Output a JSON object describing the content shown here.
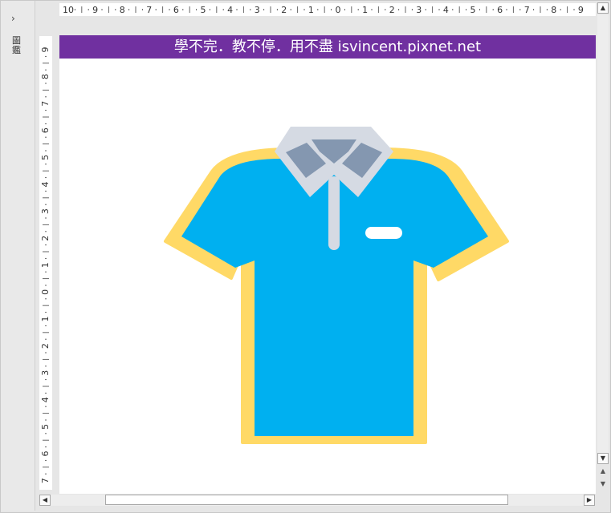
{
  "navigation": {
    "expand_glyph": "›",
    "label": "圖鑑"
  },
  "ruler": {
    "horizontal_labels": [
      "10",
      "9",
      "8",
      "7",
      "6",
      "5",
      "4",
      "3",
      "2",
      "1",
      "0",
      "1",
      "2",
      "3",
      "4",
      "5",
      "6",
      "7",
      "8",
      "9"
    ],
    "vertical_labels": [
      "9",
      "8",
      "7",
      "6",
      "5",
      "4",
      "3",
      "2",
      "1",
      "0",
      "1",
      "2",
      "3",
      "4",
      "5",
      "6",
      "7"
    ]
  },
  "banner": {
    "text": "學不完．教不停．用不盡 isvincent.pixnet.net",
    "color": "#7030a0"
  },
  "illustration": {
    "icon": "polo-shirt-icon",
    "colors": {
      "body": "#00b0f0",
      "outline": "#ffd966",
      "collar": "#d5dae3",
      "collar_inner": "#8497b0",
      "pocket": "#ffffff"
    }
  },
  "scrollbars": {
    "up_glyph": "▲",
    "down_glyph": "▼",
    "left_glyph": "◀",
    "right_glyph": "▶",
    "prev_page_glyph": "⯭",
    "next_page_glyph": "⯯"
  }
}
